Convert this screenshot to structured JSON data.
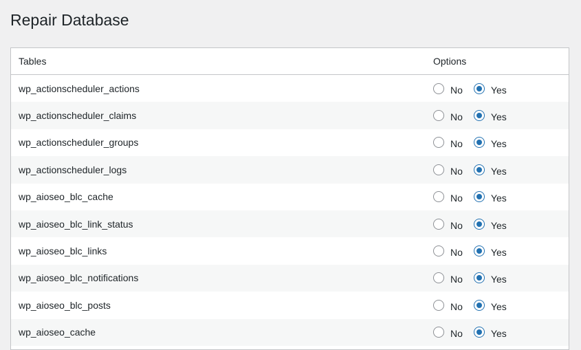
{
  "page": {
    "title": "Repair Database"
  },
  "table": {
    "headers": {
      "tables": "Tables",
      "options": "Options"
    },
    "option_labels": {
      "no": "No",
      "yes": "Yes"
    },
    "rows": [
      {
        "name": "wp_actionscheduler_actions",
        "selected": "yes"
      },
      {
        "name": "wp_actionscheduler_claims",
        "selected": "yes"
      },
      {
        "name": "wp_actionscheduler_groups",
        "selected": "yes"
      },
      {
        "name": "wp_actionscheduler_logs",
        "selected": "yes"
      },
      {
        "name": "wp_aioseo_blc_cache",
        "selected": "yes"
      },
      {
        "name": "wp_aioseo_blc_link_status",
        "selected": "yes"
      },
      {
        "name": "wp_aioseo_blc_links",
        "selected": "yes"
      },
      {
        "name": "wp_aioseo_blc_notifications",
        "selected": "yes"
      },
      {
        "name": "wp_aioseo_blc_posts",
        "selected": "yes"
      },
      {
        "name": "wp_aioseo_cache",
        "selected": "yes"
      }
    ]
  },
  "colors": {
    "accent": "#2271b1",
    "background": "#f0f0f1",
    "row_alt": "#f6f7f7",
    "border": "#c3c4c7"
  }
}
